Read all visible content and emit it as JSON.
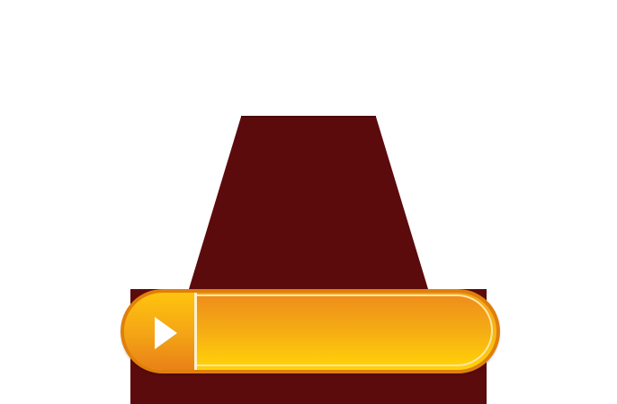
{
  "colors": {
    "backdrop": "#5c0b0d",
    "bar_border": "#e07f0b",
    "bar_fill_top": "#f2a21a",
    "bar_fill_bottom": "#ffd20a",
    "play_glyph": "#ffffff"
  },
  "player": {
    "play_icon": "play-icon",
    "progress_text": ""
  }
}
